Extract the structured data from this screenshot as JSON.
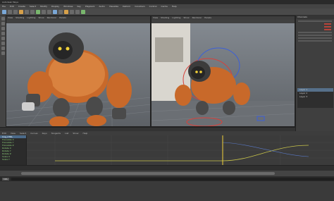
{
  "window": {
    "title": "Autodesk Maya"
  },
  "menubar": {
    "items": [
      "File",
      "Edit",
      "Create",
      "Select",
      "Modify",
      "Display",
      "Windows",
      "Key",
      "Playback",
      "Audio",
      "Visualize",
      "Deform",
      "Constrain",
      "Control",
      "Cache",
      "Help"
    ]
  },
  "viewport_left": {
    "menu": [
      "View",
      "Shading",
      "Lighting",
      "Show",
      "Renderer",
      "Panels"
    ]
  },
  "viewport_right": {
    "menu": [
      "View",
      "Shading",
      "Lighting",
      "Show",
      "Renderer",
      "Panels"
    ]
  },
  "attribute_panel": {
    "header": "Channels"
  },
  "layers": {
    "items": [
      "Layer 1",
      "Layer 2",
      "Layer 3"
    ]
  },
  "graph_editor": {
    "menu": [
      "Edit",
      "View",
      "Select",
      "Curves",
      "Keys",
      "Tangents",
      "List",
      "Show",
      "Help"
    ],
    "outliner_items": [
      "Cog_CTRL",
      "Translate X",
      "Translate Y",
      "Translate Z",
      "Rotate X",
      "Rotate Y",
      "Rotate Z",
      "Scale X",
      "Scale Y"
    ]
  },
  "command_line": {
    "mel_label": "MEL"
  },
  "colors": {
    "curve": "#c8c44a",
    "playhead": "#f2d23a",
    "robot_orange": "#c8692a"
  }
}
